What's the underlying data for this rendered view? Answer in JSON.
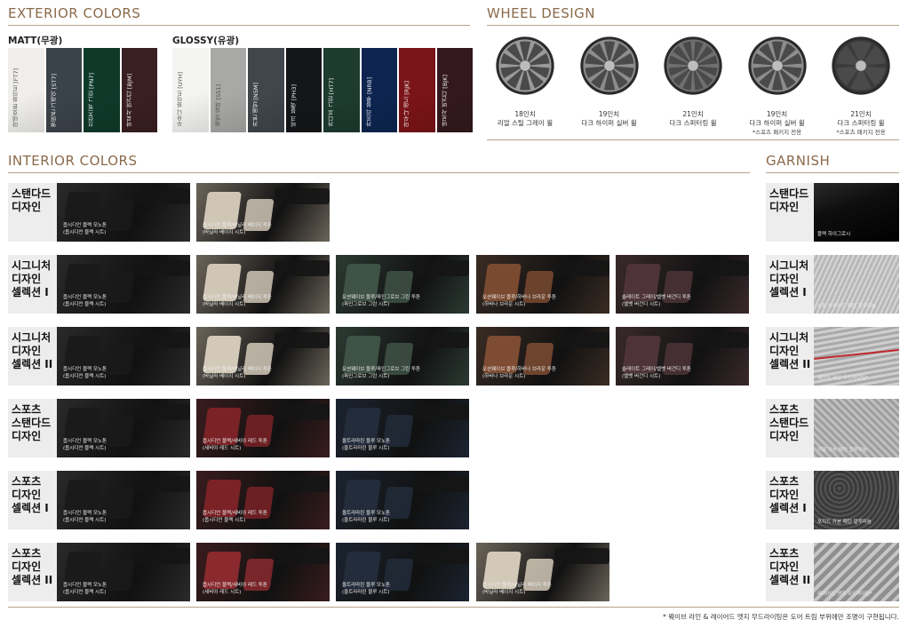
{
  "exterior": {
    "title": "EXTERIOR COLORS",
    "matt_label": "MATT(무광)",
    "glossy_label": "GLOSSY(유광)",
    "matt": [
      {
        "name": "마테호른 화이트 [FT7]",
        "color": "#f0efec"
      },
      {
        "name": "멜버른 그레이 [ST7]",
        "color": "#3b434a"
      },
      {
        "name": "브런즈윅 그린 [PN7]",
        "color": "#0f3a2a"
      },
      {
        "name": "바로사 버건디 [BJM]",
        "color": "#3a1f22"
      }
    ],
    "glossy": [
      {
        "name": "우유니 화이트 [UYH]",
        "color": "#f4f4f2"
      },
      {
        "name": "세빌 실버 [SS1]",
        "color": "#a8a8a6"
      },
      {
        "name": "카본 메탈 [N5M]",
        "color": "#3f464c"
      },
      {
        "name": "비크 블랙 [PH3]",
        "color": "#141619"
      },
      {
        "name": "카디프 그린 [HT7]",
        "color": "#1d3b2f"
      },
      {
        "name": "카프리 블루 [NRB]",
        "color": "#0d2550"
      },
      {
        "name": "마우나 레드 [RJK]",
        "color": "#7a1418"
      },
      {
        "name": "바로사 버건디 [BJK]",
        "color": "#33191e"
      }
    ]
  },
  "wheel": {
    "title": "WHEEL DESIGN",
    "items": [
      {
        "size": "18인치",
        "name": "리얼 스틸 그레이 휠",
        "note": "",
        "tone": "#9a9a9a"
      },
      {
        "size": "19인치",
        "name": "다크 하이퍼 실버 휠",
        "note": "",
        "tone": "#8c8c8c"
      },
      {
        "size": "21인치",
        "name": "다크 스퍼터링 휠",
        "note": "",
        "tone": "#6f6f6f"
      },
      {
        "size": "19인치",
        "name": "다크 하이퍼 실버 휠",
        "note": "*스포츠 패키지 전용",
        "tone": "#8c8c8c"
      },
      {
        "size": "21인치",
        "name": "다크 스퍼터링 휠",
        "note": "*스포츠 패키지 전용",
        "tone": "#3a3a3a"
      }
    ]
  },
  "interior": {
    "title": "INTERIOR COLORS",
    "rows": [
      {
        "label": [
          "스탠다드",
          "디자인"
        ],
        "items": [
          {
            "cap1": "옵시디언 블랙 모노톤",
            "cap2": "(옵시디언 블랙 시트)",
            "bg": "#2a2a2a",
            "seat": "#1a1a1a"
          },
          {
            "cap1": "옵시디언 블랙/바닐라 베이지 투톤",
            "cap2": "(바닐라 베이지 시트)",
            "bg": "#6b645a",
            "seat": "#cfc6b6"
          }
        ]
      },
      {
        "label": [
          "시그니처",
          "디자인",
          "셀렉션 I"
        ],
        "items": [
          {
            "cap1": "옵시디언 블랙 모노톤",
            "cap2": "(옵시디언 블랙 시트)",
            "bg": "#2a2a2a",
            "seat": "#1a1a1a"
          },
          {
            "cap1": "옵시디언 블랙/바닐라 베이지 투톤",
            "cap2": "(바닐라 베이지 시트)",
            "bg": "#6b645a",
            "seat": "#cfc6b6"
          },
          {
            "cap1": "오션웨이브 블루/파인그로브 그린 투톤",
            "cap2": "(파인그로브 그린 시트)",
            "bg": "#2c3a33",
            "seat": "#3f5246"
          },
          {
            "cap1": "오션웨이브 블루/하바나 브라운 투톤",
            "cap2": "(하바나 브라운 시트)",
            "bg": "#3a2c24",
            "seat": "#7a4a30"
          },
          {
            "cap1": "슬레이트 그레이/벨벳 버건디 투톤",
            "cap2": "(벨벳 버건디 시트)",
            "bg": "#3a2a2c",
            "seat": "#4e3438"
          }
        ]
      },
      {
        "label": [
          "시그니처",
          "디자인",
          "셀렉션 II"
        ],
        "items": [
          {
            "cap1": "옵시디언 블랙 모노톤",
            "cap2": "(옵시디언 블랙 시트)",
            "bg": "#2a2a2a",
            "seat": "#1a1a1a"
          },
          {
            "cap1": "옵시디언 블랙/바닐라 베이지 투톤",
            "cap2": "(바닐라 베이지 시트)",
            "bg": "#6b645a",
            "seat": "#d2c9b8"
          },
          {
            "cap1": "오션웨이브 블루/파인그로브 그린 투톤",
            "cap2": "(파인그로브 그린 시트)",
            "bg": "#2c3a33",
            "seat": "#3f5246"
          },
          {
            "cap1": "오션웨이브 블루/하바나 브라운 투톤",
            "cap2": "(하바나 브라운 시트)",
            "bg": "#3a2c24",
            "seat": "#7e4c32"
          },
          {
            "cap1": "슬레이트 그레이/벨벳 버건디 투톤",
            "cap2": "(벨벳 버건디 시트)",
            "bg": "#3a2a2c",
            "seat": "#4e3438"
          }
        ]
      },
      {
        "label": [
          "스포츠",
          "스탠다드",
          "디자인"
        ],
        "items": [
          {
            "cap1": "옵시디언 블랙 모노톤",
            "cap2": "(옵시디언 블랙 시트)",
            "bg": "#2a2a2a",
            "seat": "#1a1a1a"
          },
          {
            "cap1": "옵시디언 블랙/세비야 레드 투톤",
            "cap2": "(세비야 레드 시트)",
            "bg": "#3a1c1e",
            "seat": "#7a2226"
          },
          {
            "cap1": "울트라마린 블루 모노톤",
            "cap2": "(울트라마린 블루 시트)",
            "bg": "#1c2430",
            "seat": "#222c3a"
          }
        ]
      },
      {
        "label": [
          "스포츠",
          "디자인",
          "셀렉션 I"
        ],
        "items": [
          {
            "cap1": "옵시디언 블랙 모노톤",
            "cap2": "(옵시디언 블랙 시트)",
            "bg": "#2a2a2a",
            "seat": "#1a1a1a"
          },
          {
            "cap1": "옵시디언 블랙/세비야 레드 투톤",
            "cap2": "(옵시디언 블랙 시트)",
            "bg": "#3a1c1e",
            "seat": "#7a2226"
          },
          {
            "cap1": "울트라마린 블루 모노톤",
            "cap2": "(울트라마린 블루 시트)",
            "bg": "#1c2430",
            "seat": "#222c3a"
          }
        ]
      },
      {
        "label": [
          "스포츠",
          "디자인",
          "셀렉션 II"
        ],
        "items": [
          {
            "cap1": "옵시디언 블랙 모노톤",
            "cap2": "(옵시디언 블랙 시트)",
            "bg": "#2a2a2a",
            "seat": "#1a1a1a"
          },
          {
            "cap1": "옵시디언 블랙/세비야 레드 투톤",
            "cap2": "(세비야 레드 시트)",
            "bg": "#3a1c1e",
            "seat": "#8a2a2e"
          },
          {
            "cap1": "울트라마린 블루 모노톤",
            "cap2": "(울트라마린 블루 시트)",
            "bg": "#1c2430",
            "seat": "#222c3a"
          },
          {
            "cap1": "옵시디언 블랙/바닐라 베이지 투톤",
            "cap2": "(바닐라 베이지 시트)",
            "bg": "#6b645a",
            "seat": "#d2c9b8"
          }
        ]
      }
    ]
  },
  "garnish": {
    "title": "GARNISH",
    "rows": [
      {
        "label": [
          "스탠다드",
          "디자인"
        ],
        "cap": "블랙 하이그로시",
        "bg": "#0e0e0e",
        "pattern": "gloss"
      },
      {
        "label": [
          "시그니처",
          "디자인",
          "셀렉션 I"
        ],
        "cap": "스핀 브러쉬드 패턴 알루미늄",
        "bg": "#b8b8b8",
        "pattern": "brushed"
      },
      {
        "label": [
          "시그니처",
          "디자인",
          "셀렉션 II"
        ],
        "cap": "웨이브 라인 무드라이팅*",
        "bg": "#a9a9a9",
        "pattern": "wave"
      },
      {
        "label": [
          "스포츠",
          "스탠다드",
          "디자인"
        ],
        "cap": "리얼 카본 패턴 알루미늄",
        "bg": "#9d9d9d",
        "pattern": "carbon"
      },
      {
        "label": [
          "스포츠",
          "디자인",
          "셀렉션 I"
        ],
        "cap": "포지드 카본 패턴 알루미늄",
        "bg": "#3a3a3a",
        "pattern": "forged"
      },
      {
        "label": [
          "스포츠",
          "디자인",
          "셀렉션 II"
        ],
        "cap": "레이어드 엣지 무드라이팅*",
        "bg": "#8f8f8f",
        "pattern": "layered"
      }
    ]
  },
  "footnote": "* 웨이브 라인 & 레이어드 엣지 무드라이팅은 도어 트림 부위에만 조명이 구현됩니다."
}
